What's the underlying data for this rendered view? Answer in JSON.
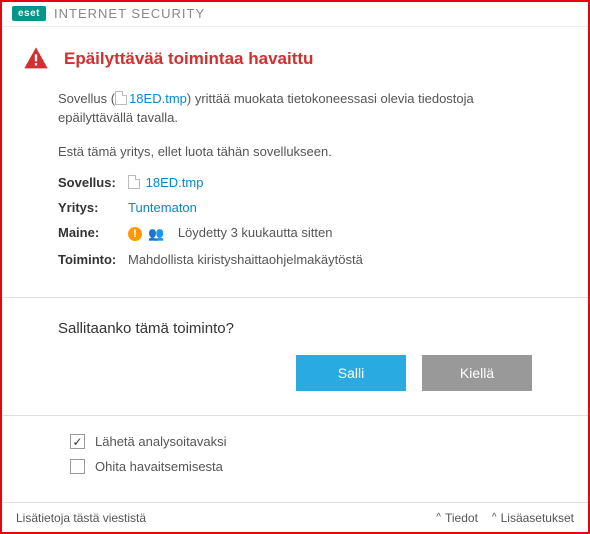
{
  "titlebar": {
    "logo": "eset",
    "product": "INTERNET SECURITY"
  },
  "header": {
    "title": "Epäilyttävää toimintaa havaittu"
  },
  "description": {
    "prefix": "Sovellus (",
    "filename": "18ED.tmp",
    "suffix": ") yrittää muokata tietokoneessasi olevia tiedostoja epäilyttävällä tavalla."
  },
  "instruction": "Estä tämä yritys, ellet luota tähän sovellukseen.",
  "details": {
    "app_label": "Sovellus:",
    "app_value": "18ED.tmp",
    "company_label": "Yritys:",
    "company_value": "Tuntematon",
    "reputation_label": "Maine:",
    "reputation_value": "Löydetty 3 kuukautta sitten",
    "action_label": "Toiminto:",
    "action_value": "Mahdollista kiristyshaittaohjelmakäytöstä"
  },
  "question": "Sallitaanko tämä toiminto?",
  "buttons": {
    "allow": "Salli",
    "deny": "Kiellä"
  },
  "checks": {
    "submit": "Lähetä analysoitavaksi",
    "exclude": "Ohita havaitsemisesta"
  },
  "footer": {
    "info": "Lisätietoja tästä viestistä",
    "details": "Tiedot",
    "adv": "Lisäasetukset"
  }
}
